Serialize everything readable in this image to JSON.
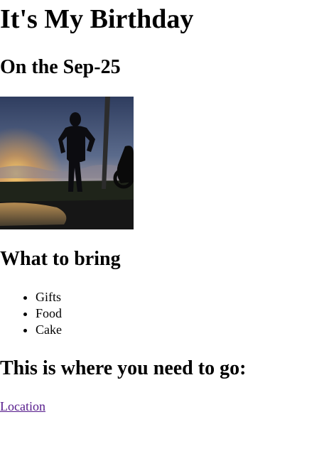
{
  "page": {
    "title": "It's My Birthday",
    "date_heading": "On the Sep-25",
    "photo_alt": "Silhouette at sunset",
    "bring_heading": "What to bring",
    "bring_items": [
      "Gifts",
      "Food",
      "Cake"
    ],
    "go_heading": "This is where you need to go:",
    "location_link": "Location"
  },
  "colors": {
    "visited_link": "#551a8b",
    "text": "#000000",
    "background": "#ffffff"
  }
}
